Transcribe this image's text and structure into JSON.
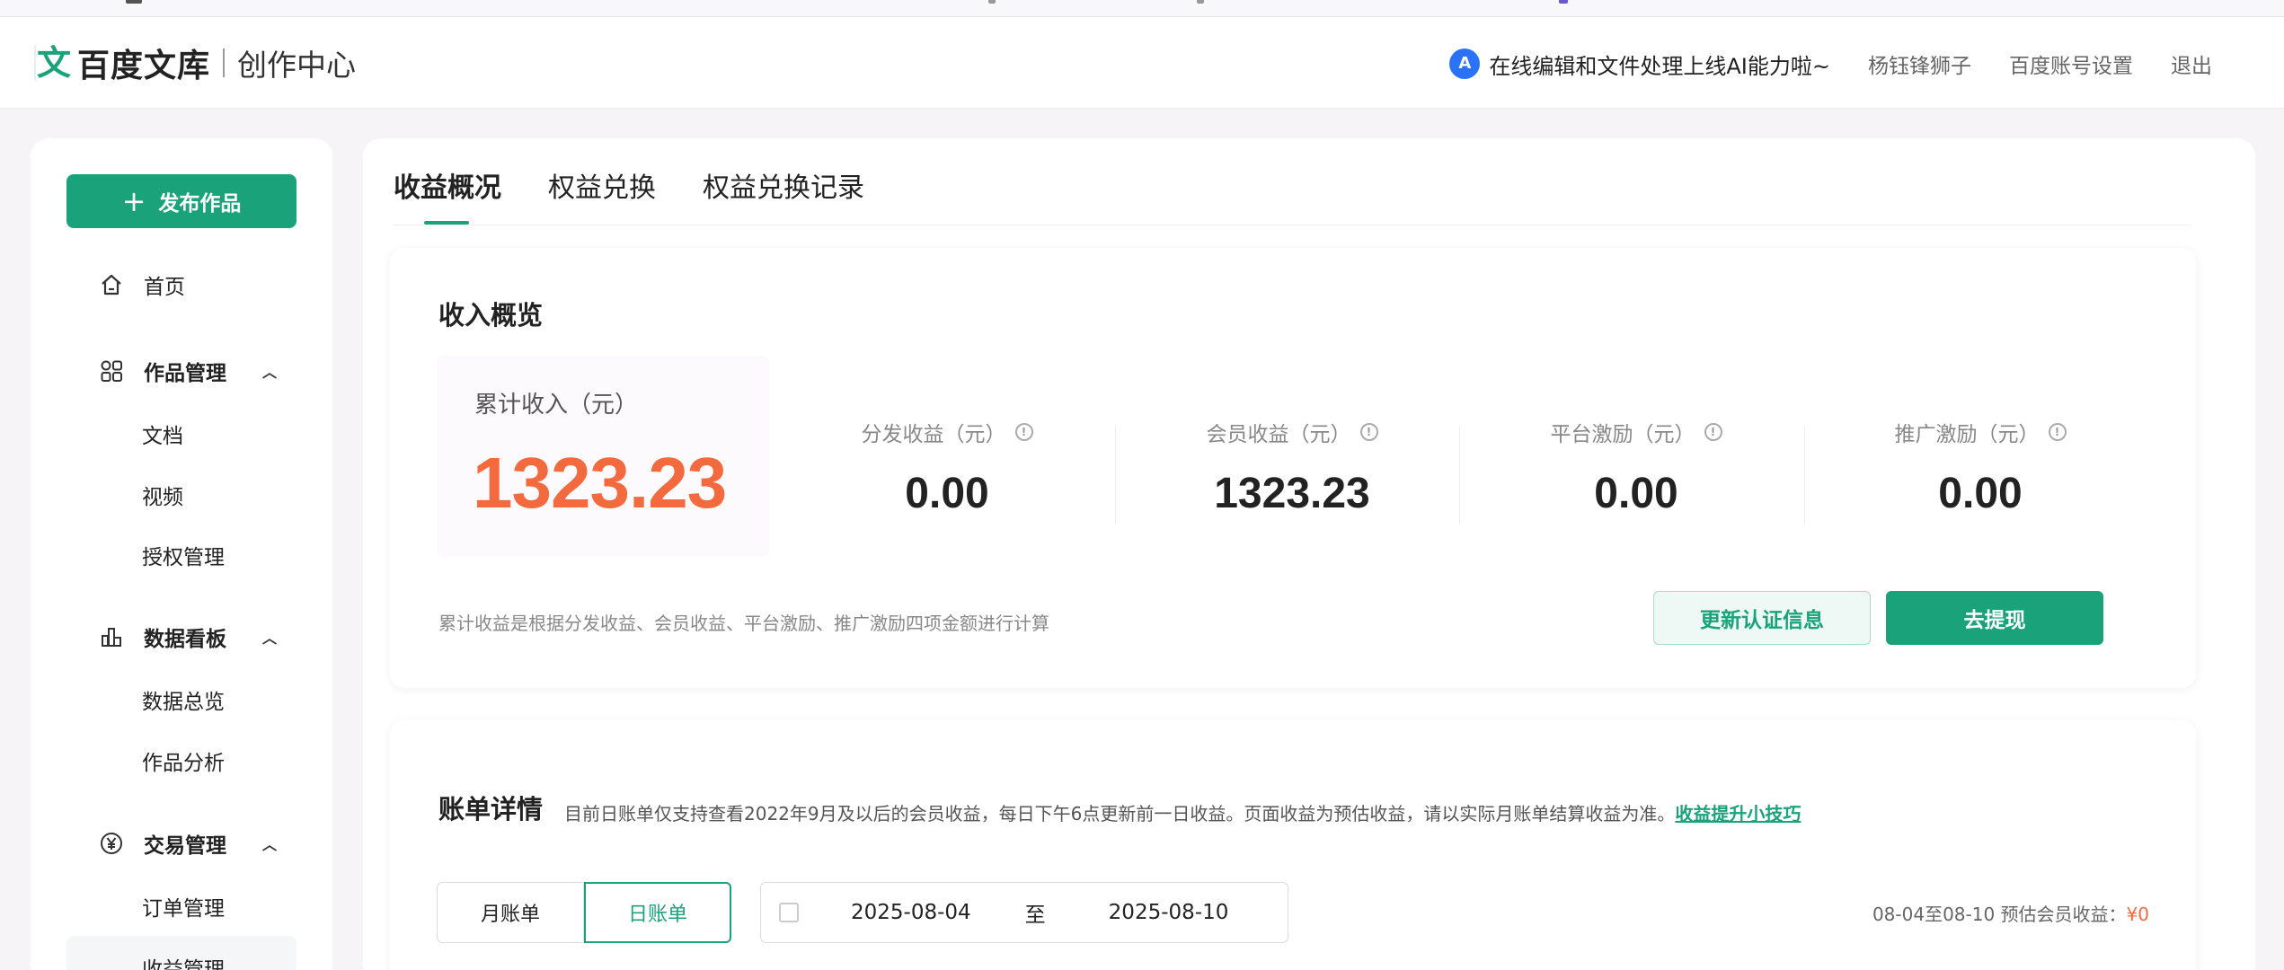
{
  "header": {
    "logo_mark": "文",
    "logo_text": "百度文库",
    "logo_sub": "创作中心",
    "promo_icon": "A",
    "promo_text": "在线编辑和文件处理上线AI能力啦~",
    "user_name": "杨钰锋狮子",
    "account_settings": "百度账号设置",
    "logout": "退出"
  },
  "sidebar": {
    "publish_label": "发布作品",
    "home": "首页",
    "works_group": "作品管理",
    "works_items": [
      "文档",
      "视频",
      "授权管理"
    ],
    "data_group": "数据看板",
    "data_items": [
      "数据总览",
      "作品分析"
    ],
    "trade_group": "交易管理",
    "trade_items": [
      "订单管理",
      "收益管理"
    ]
  },
  "tabs": [
    "收益概况",
    "权益兑换",
    "权益兑换记录"
  ],
  "income": {
    "title": "收入概览",
    "total_label": "累计收入（元）",
    "total_value": "1323.23",
    "stats": [
      {
        "label": "分发收益（元）",
        "value": "0.00"
      },
      {
        "label": "会员收益（元）",
        "value": "1323.23"
      },
      {
        "label": "平台激励（元）",
        "value": "0.00"
      },
      {
        "label": "推广激励（元）",
        "value": "0.00"
      }
    ],
    "note": "累计收益是根据分发收益、会员收益、平台激励、推广激励四项金额进行计算",
    "update_button": "更新认证信息",
    "withdraw_button": "去提现"
  },
  "bill": {
    "title": "账单详情",
    "desc": "目前日账单仅支持查看2022年9月及以后的会员收益，每日下午6点更新前一日收益。页面收益为预估收益，请以实际月账单结算收益为准。",
    "tips_link": "收益提升小技巧",
    "month_tab": "月账单",
    "day_tab": "日账单",
    "date_from": "2025-08-04",
    "to_label": "至",
    "date_to": "2025-08-10",
    "estimate_label": "08-04至08-10 预估会员收益：",
    "estimate_amount": "¥0"
  },
  "colors": {
    "brand": "#1aa37a",
    "accent_orange": "#f26a3d"
  }
}
